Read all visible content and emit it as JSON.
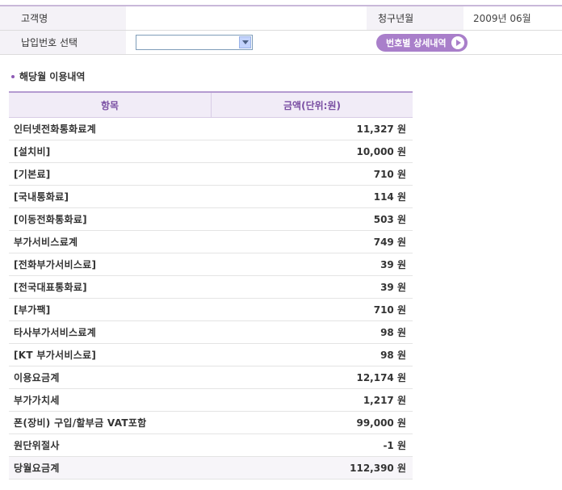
{
  "info": {
    "customer_label": "고객명",
    "customer_value": "",
    "billing_month_label": "청구년월",
    "billing_month_value": "2009년 06월",
    "payment_number_label": "납입번호 선택",
    "payment_number_value": "",
    "detail_button_label": "번호별 상세내역"
  },
  "section": {
    "title": "해당월 이용내역"
  },
  "usage": {
    "headers": [
      "항목",
      "금액(단위:원)"
    ],
    "rows": [
      {
        "item": "인터넷전화통화료계",
        "amount": "11,327 원"
      },
      {
        "item": "[설치비]",
        "amount": "10,000 원"
      },
      {
        "item": "[기본료]",
        "amount": "710 원"
      },
      {
        "item": "[국내통화료]",
        "amount": "114 원"
      },
      {
        "item": "[이동전화통화료]",
        "amount": "503 원"
      },
      {
        "item": "부가서비스료계",
        "amount": "749 원"
      },
      {
        "item": "[전화부가서비스료]",
        "amount": "39 원"
      },
      {
        "item": "[전국대표통화료]",
        "amount": "39 원"
      },
      {
        "item": "[부가팩]",
        "amount": "710 원"
      },
      {
        "item": "타사부가서비스료계",
        "amount": "98 원"
      },
      {
        "item": "[KT 부가서비스료]",
        "amount": "98 원"
      },
      {
        "item": "이용요금계",
        "amount": "12,174 원"
      },
      {
        "item": "부가가치세",
        "amount": "1,217 원"
      },
      {
        "item": "폰(장비) 구입/할부금 VAT포함",
        "amount": "99,000 원"
      },
      {
        "item": "원단위절사",
        "amount": "-1 원"
      },
      {
        "item": "당월요금계",
        "amount": "112,390 원"
      }
    ]
  },
  "colors": {
    "accent": "#a97fca",
    "header_text": "#7a4fa3"
  }
}
